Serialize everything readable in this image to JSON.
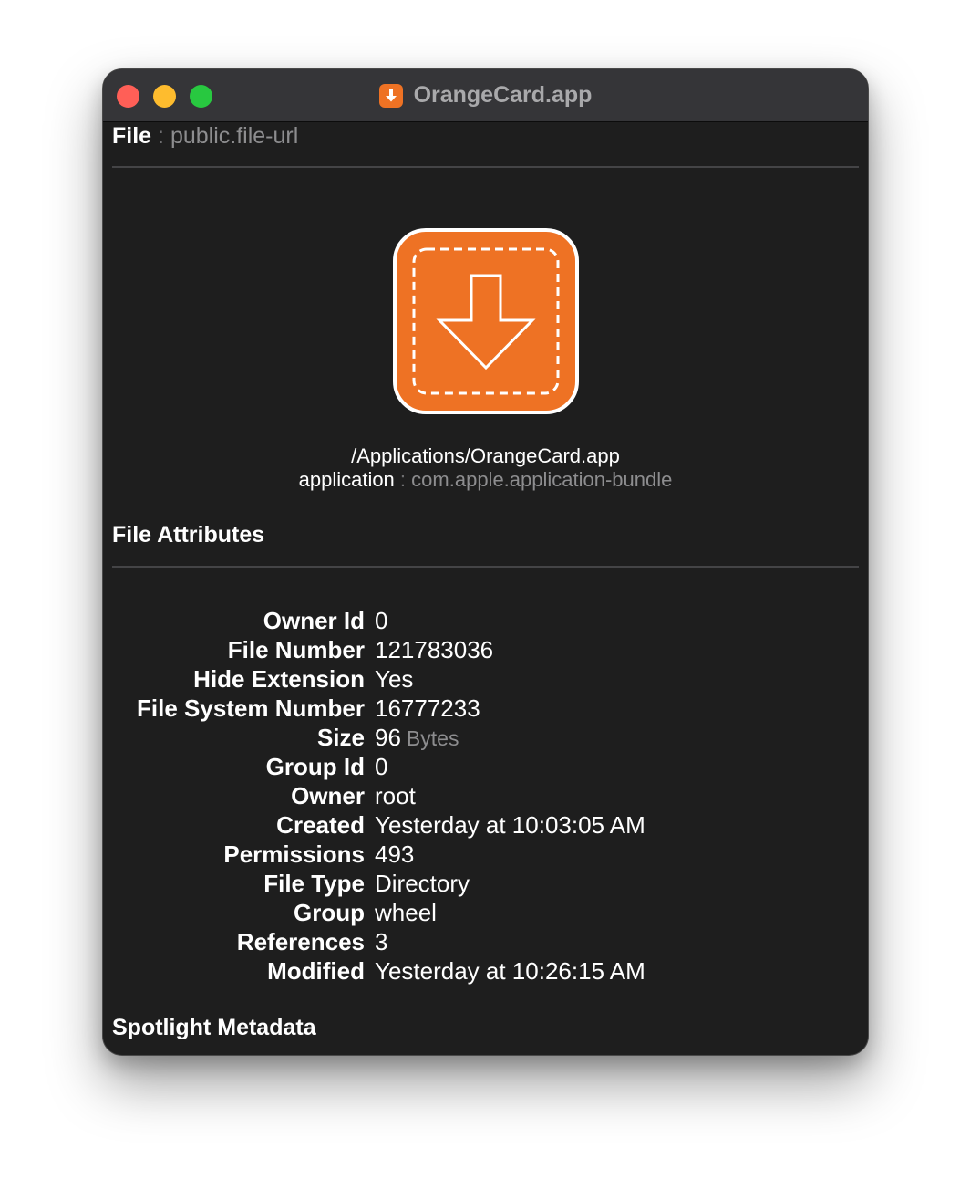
{
  "window": {
    "title": "OrangeCard.app",
    "title_icon": "download-arrow-icon"
  },
  "colors": {
    "window_bg": "#1e1e1e",
    "titlebar_bg": "#353538",
    "accent_orange": "#ee7224",
    "close": "#ff5f57",
    "minimize": "#febc2e",
    "zoom": "#28c840"
  },
  "header": {
    "type_label": "File",
    "separator": ":",
    "type_value": "public.file-url"
  },
  "file": {
    "icon": "orangecard-app-icon",
    "path": "/Applications/OrangeCard.app",
    "kind_label": "application",
    "separator": ":",
    "uti": "com.apple.application-bundle"
  },
  "sections": {
    "attributes_title": "File Attributes",
    "spotlight_title": "Spotlight Metadata"
  },
  "attributes": [
    {
      "key": "Owner Id",
      "value": "0",
      "unit": ""
    },
    {
      "key": "File Number",
      "value": "121783036",
      "unit": ""
    },
    {
      "key": "Hide Extension",
      "value": "Yes",
      "unit": ""
    },
    {
      "key": "File System Number",
      "value": "16777233",
      "unit": ""
    },
    {
      "key": "Size",
      "value": "96",
      "unit": "Bytes"
    },
    {
      "key": "Group Id",
      "value": "0",
      "unit": ""
    },
    {
      "key": "Owner",
      "value": "root",
      "unit": ""
    },
    {
      "key": "Created",
      "value": "Yesterday at 10:03:05 AM",
      "unit": ""
    },
    {
      "key": "Permissions",
      "value": "493",
      "unit": ""
    },
    {
      "key": "File Type",
      "value": "Directory",
      "unit": ""
    },
    {
      "key": "Group",
      "value": "wheel",
      "unit": ""
    },
    {
      "key": "References",
      "value": "3",
      "unit": ""
    },
    {
      "key": "Modified",
      "value": "Yesterday at 10:26:15 AM",
      "unit": ""
    }
  ]
}
